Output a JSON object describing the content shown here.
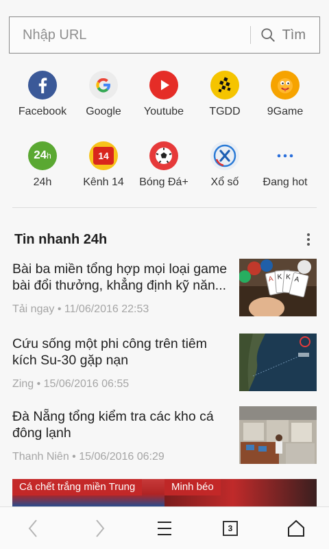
{
  "url_bar": {
    "placeholder": "Nhập URL",
    "search_label": "Tìm"
  },
  "shortcuts": [
    {
      "label": "Facebook",
      "icon": "facebook-icon",
      "color": "#3b5998"
    },
    {
      "label": "Google",
      "icon": "google-icon",
      "color": "#ececec"
    },
    {
      "label": "Youtube",
      "icon": "youtube-icon",
      "color": "#e52d27"
    },
    {
      "label": "TGDD",
      "icon": "tgdd-icon",
      "color": "#f5c400"
    },
    {
      "label": "9Game",
      "icon": "9game-icon",
      "color": "#f6a300"
    },
    {
      "label": "24h",
      "icon": "24h-icon",
      "color": "#5aa832"
    },
    {
      "label": "Kênh 14",
      "icon": "kenh14-icon",
      "color": "#f7c31a",
      "icon_text": "14"
    },
    {
      "label": "Bóng Đá+",
      "icon": "soccer-ball-icon",
      "color": "#e63a3a"
    },
    {
      "label": "Xổ số",
      "icon": "xoso-icon",
      "color": "#e9eef5"
    },
    {
      "label": "Đang hot",
      "icon": "more-dots-icon",
      "color": "#2a6fdb"
    }
  ],
  "news": {
    "section_title": "Tin nhanh 24h",
    "items": [
      {
        "title": "Bài ba miền tổng hợp mọi loại game  bài đổi thưởng, khẳng định kỹ năn...",
        "source": "Tải ngay",
        "time": "11/06/2016 22:53",
        "thumb": "playing-cards-image"
      },
      {
        "title": "Cứu sống một phi công trên tiêm kích Su-30 gặp nạn",
        "source": "Zing",
        "time": "15/06/2016 06:55",
        "thumb": "sea-map-image"
      },
      {
        "title": "Đà Nẵng tổng kiểm tra các kho cá đông lạnh",
        "source": "Thanh Niên",
        "time": "15/06/2016 06:29",
        "thumb": "cold-storage-image"
      }
    ]
  },
  "banner": {
    "left_label": "Cá chết trắng miền Trung",
    "right_label": "Minh béo"
  },
  "bottom_nav": {
    "tab_count": "3"
  }
}
